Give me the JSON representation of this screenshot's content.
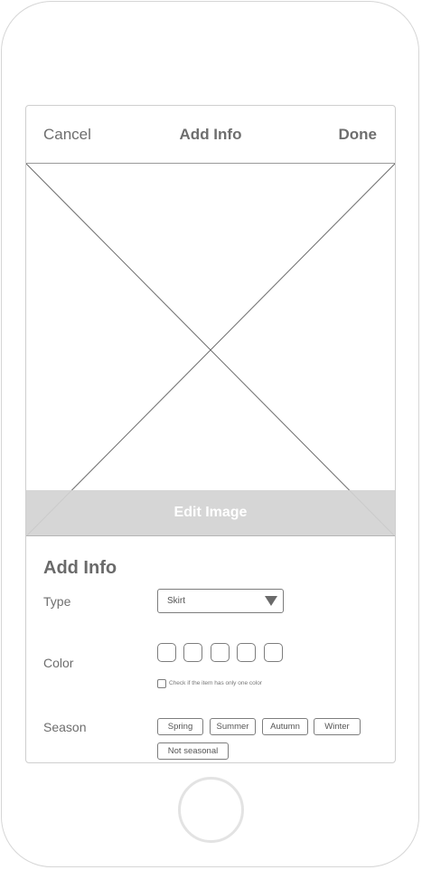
{
  "nav": {
    "cancel_label": "Cancel",
    "title": "Add Info",
    "done_label": "Done"
  },
  "image": {
    "edit_label": "Edit Image"
  },
  "form": {
    "section_title": "Add Info",
    "type_label": "Type",
    "type_value": "Skirt",
    "color_label": "Color",
    "single_color_checkbox_label": "Check if the item has only one color",
    "season_label": "Season",
    "seasons": [
      "Spring",
      "Summer",
      "Autumn",
      "Winter",
      "Not seasonal"
    ]
  }
}
